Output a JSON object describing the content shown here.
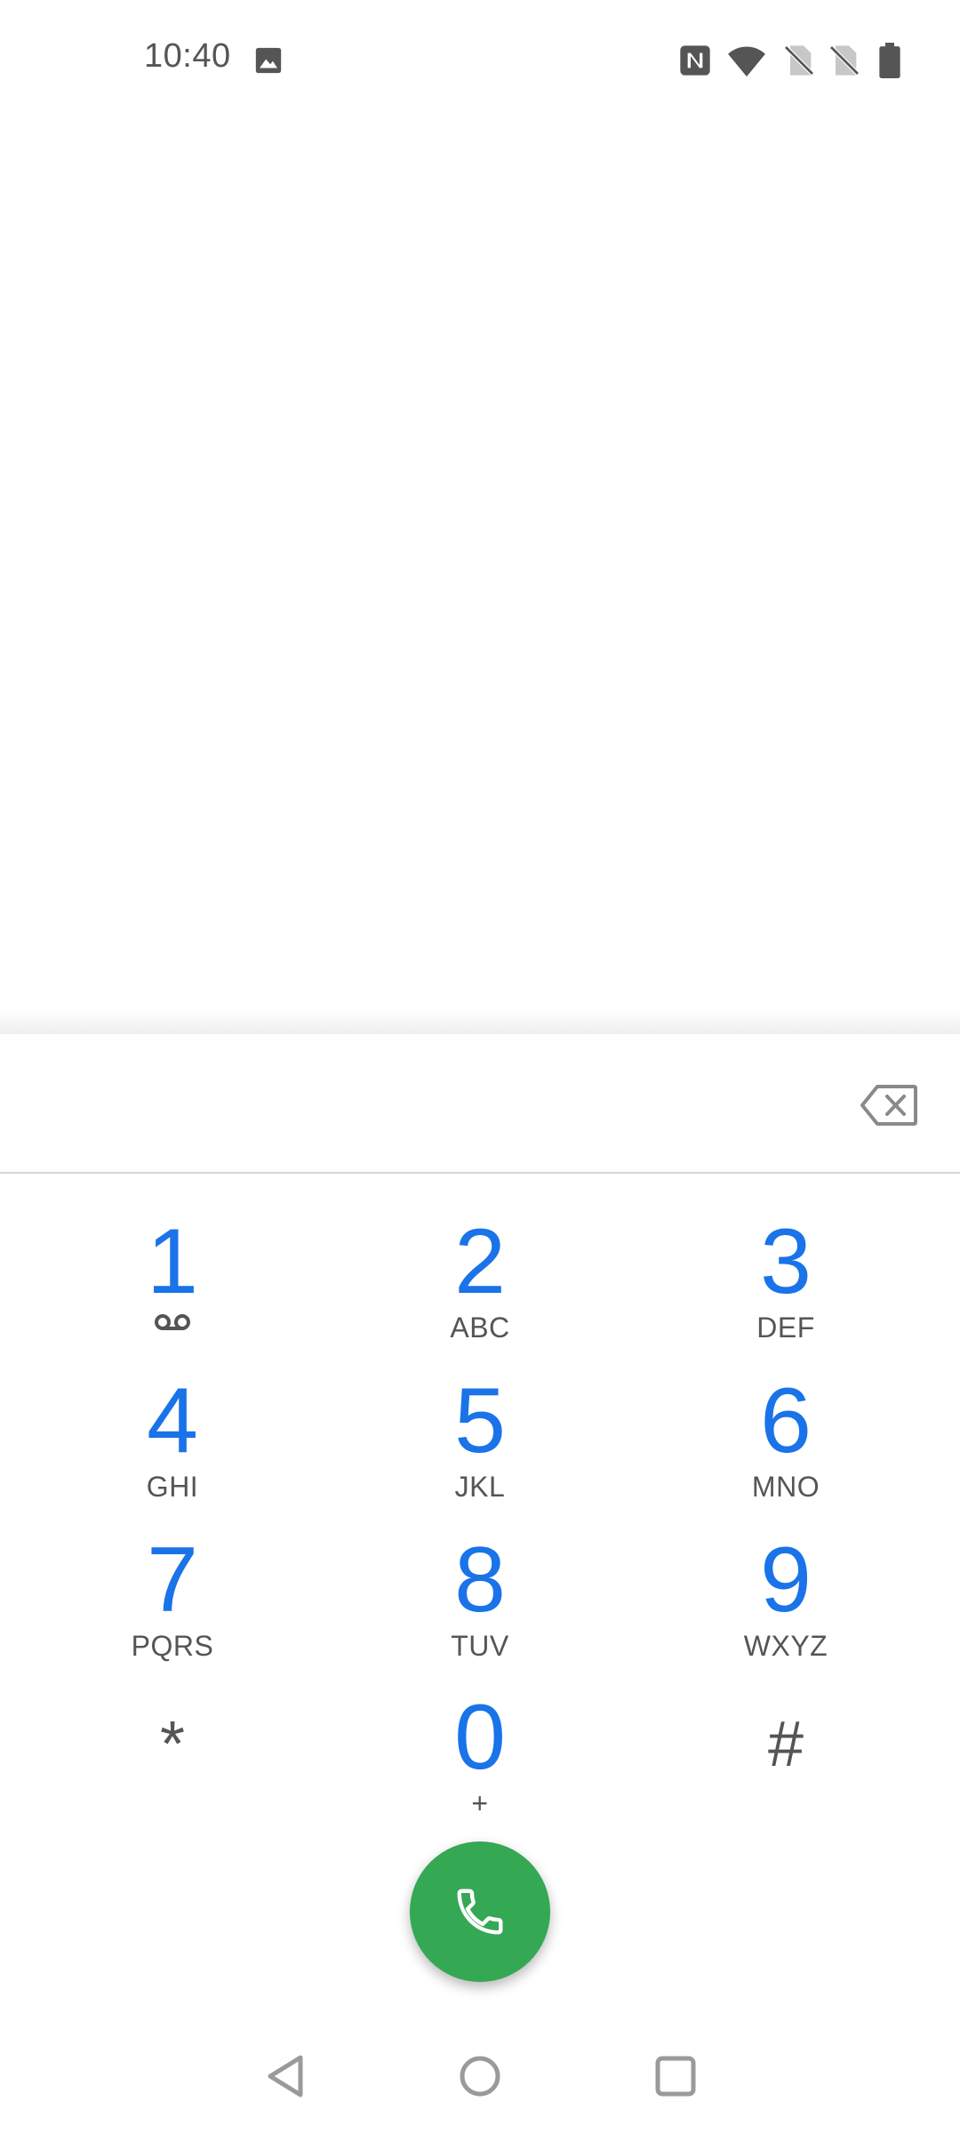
{
  "status_bar": {
    "time": "10:40",
    "left_icons": [
      "photo-icon"
    ],
    "right_icons": [
      "nfc-icon",
      "wifi-icon",
      "no-sim-icon",
      "no-sim-icon",
      "battery-icon"
    ]
  },
  "dialer": {
    "digits_value": "",
    "keys": [
      {
        "digit": "1",
        "letters": "",
        "sub_icon": "voicemail-icon"
      },
      {
        "digit": "2",
        "letters": "ABC"
      },
      {
        "digit": "3",
        "letters": "DEF"
      },
      {
        "digit": "4",
        "letters": "GHI"
      },
      {
        "digit": "5",
        "letters": "JKL"
      },
      {
        "digit": "6",
        "letters": "MNO"
      },
      {
        "digit": "7",
        "letters": "PQRS"
      },
      {
        "digit": "8",
        "letters": "TUV"
      },
      {
        "digit": "9",
        "letters": "WXYZ"
      },
      {
        "digit": "*",
        "letters": ""
      },
      {
        "digit": "0",
        "letters": "+"
      },
      {
        "digit": "#",
        "letters": ""
      }
    ],
    "call_button_icon": "phone-icon",
    "backspace_icon": "backspace-icon"
  },
  "nav_bar": {
    "icons": [
      "back-icon",
      "home-icon",
      "recents-icon"
    ]
  },
  "colors": {
    "accent": "#1a73e8",
    "call_green": "#34a853",
    "text_gray": "#555555",
    "divider": "#d6d6d6"
  }
}
